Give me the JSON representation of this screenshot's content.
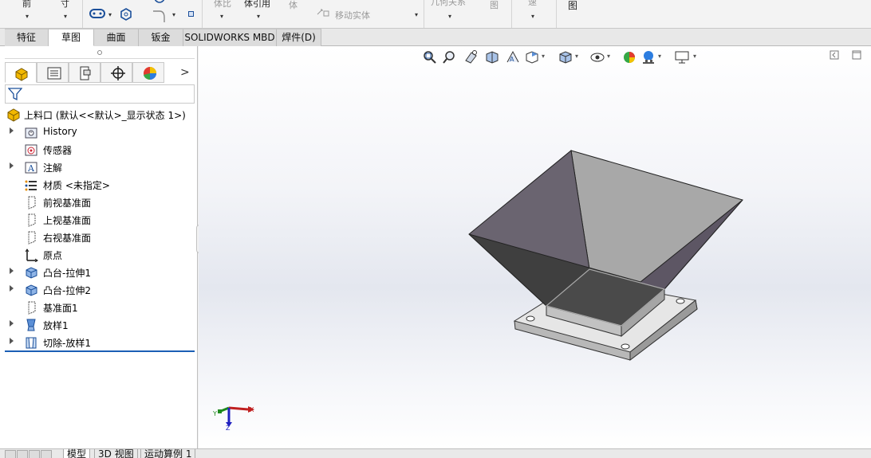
{
  "ribbon": {
    "left_label_1": "前",
    "left_label_2": "寸",
    "solid_label": "体比",
    "feature_label": "体引用",
    "body_label": "体",
    "move_label": "移动实体",
    "geo_label": "几何关系",
    "view_label": "图",
    "fix_label": "速",
    "right_label": "图"
  },
  "tabs": [
    {
      "label": "特征"
    },
    {
      "label": "草图"
    },
    {
      "label": "曲面"
    },
    {
      "label": "钣金"
    },
    {
      "label": "SOLIDWORKS MBD"
    },
    {
      "label": "焊件(D)"
    }
  ],
  "feature_tree": {
    "root": "上料口  (默认<<默认>_显示状态 1>)",
    "items": [
      {
        "label": "History",
        "icon": "history-folder-icon",
        "expandable": true
      },
      {
        "label": "传感器",
        "icon": "sensor-icon",
        "expandable": false
      },
      {
        "label": "注解",
        "icon": "annotation-icon",
        "expandable": true
      },
      {
        "label": "材质 <未指定>",
        "icon": "material-icon",
        "expandable": false
      },
      {
        "label": "前视基准面",
        "icon": "plane-icon",
        "expandable": false
      },
      {
        "label": "上视基准面",
        "icon": "plane-icon",
        "expandable": false
      },
      {
        "label": "右视基准面",
        "icon": "plane-icon",
        "expandable": false
      },
      {
        "label": "原点",
        "icon": "origin-icon",
        "expandable": false
      },
      {
        "label": "凸台-拉伸1",
        "icon": "boss-extrude-icon",
        "expandable": true
      },
      {
        "label": "凸台-拉伸2",
        "icon": "boss-extrude-icon",
        "expandable": true
      },
      {
        "label": "基准面1",
        "icon": "plane-icon",
        "expandable": false
      },
      {
        "label": "放样1",
        "icon": "loft-icon",
        "expandable": true
      },
      {
        "label": "切除-放样1",
        "icon": "cut-loft-icon",
        "expandable": true
      }
    ]
  },
  "triad": {
    "x": "X",
    "y": "Y",
    "z": "Z"
  },
  "bottom_tabs": [
    {
      "label": "模型"
    },
    {
      "label": "3D 视图"
    },
    {
      "label": "运动算例 1"
    }
  ],
  "colors": {
    "accent": "#1b5fb5",
    "model_dark": "#5f5a66",
    "model_light": "#a9a9a9",
    "plate": "#c8c8c8"
  }
}
